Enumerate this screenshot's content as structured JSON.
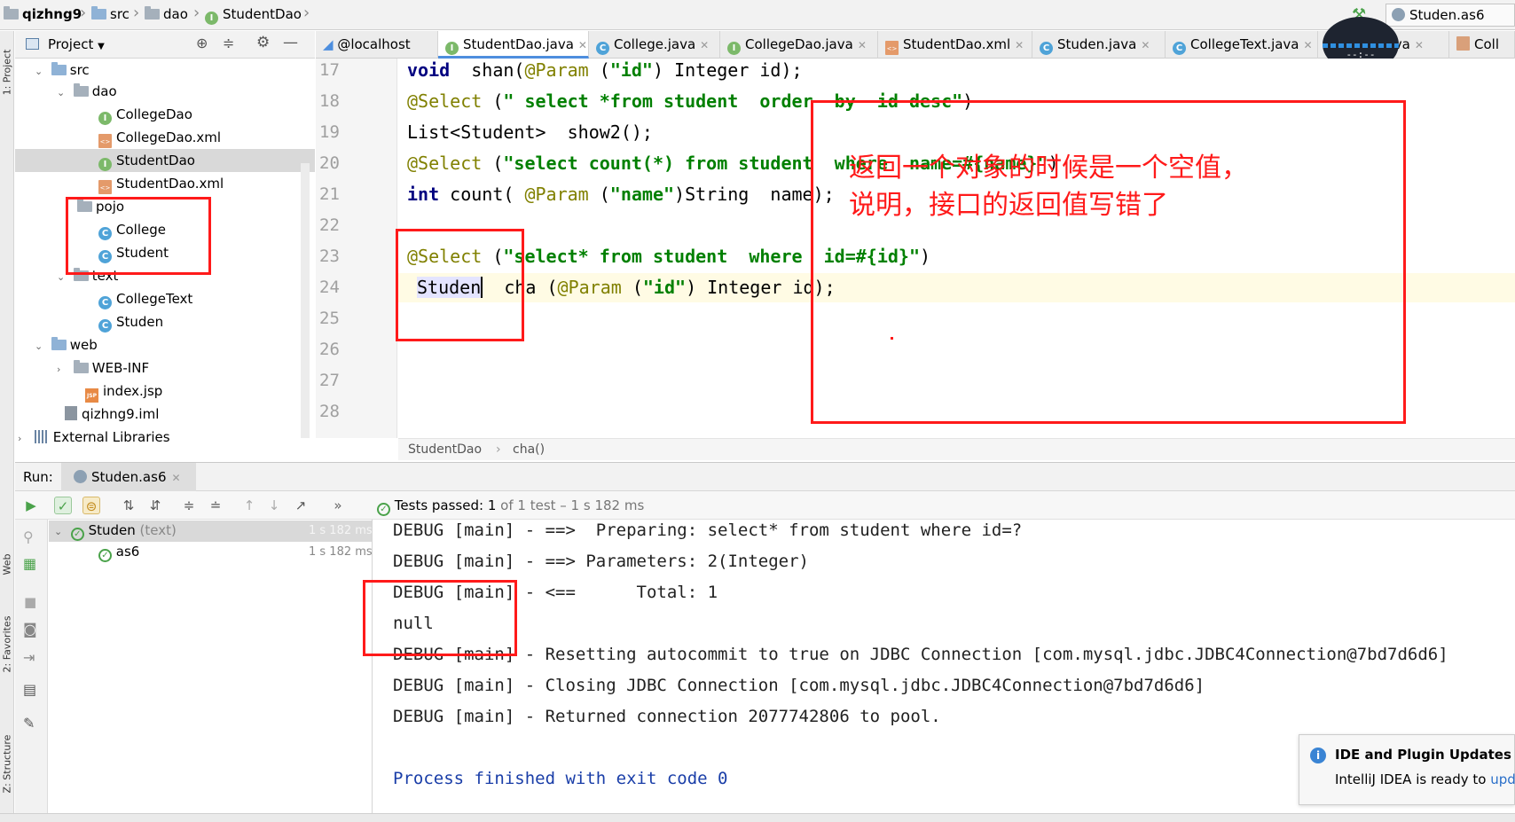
{
  "navbar": {
    "crumbs": [
      "qizhng9",
      "src",
      "dao",
      "StudentDao"
    ],
    "run_config": "Studen.as6"
  },
  "left_stripe": {
    "project": "1: Project",
    "web": "Web",
    "favorites": "2: Favorites",
    "structure": "Z: Structure"
  },
  "project_panel": {
    "title": "Project",
    "tree": [
      {
        "label": "src",
        "icon": "folder-icon"
      },
      {
        "label": "dao",
        "icon": "package-icon"
      },
      {
        "label": "CollegeDao",
        "icon": "interface-icon"
      },
      {
        "label": "CollegeDao.xml",
        "icon": "xml-file-icon"
      },
      {
        "label": "StudentDao",
        "icon": "interface-icon"
      },
      {
        "label": "StudentDao.xml",
        "icon": "xml-file-icon"
      },
      {
        "label": "pojo",
        "icon": "package-icon"
      },
      {
        "label": "College",
        "icon": "class-icon"
      },
      {
        "label": "Student",
        "icon": "class-icon"
      },
      {
        "label": "text",
        "icon": "package-icon"
      },
      {
        "label": "CollegeText",
        "icon": "class-icon"
      },
      {
        "label": "Studen",
        "icon": "class-icon"
      },
      {
        "label": "web",
        "icon": "folder-icon"
      },
      {
        "label": "WEB-INF",
        "icon": "folder-icon"
      },
      {
        "label": "index.jsp",
        "icon": "jsp-file-icon"
      },
      {
        "label": "qizhng9.iml",
        "icon": "iml-file-icon"
      },
      {
        "label": "External Libraries",
        "icon": "library-icon"
      }
    ]
  },
  "tabs": [
    {
      "label": "@localhost"
    },
    {
      "label": "StudentDao.java"
    },
    {
      "label": "College.java"
    },
    {
      "label": "CollegeDao.java"
    },
    {
      "label": "StudentDao.xml"
    },
    {
      "label": "Studen.java"
    },
    {
      "label": "CollegeText.java"
    },
    {
      "label": "udent.java"
    },
    {
      "label": "Coll"
    }
  ],
  "editor": {
    "line_numbers": [
      "17",
      "18",
      "19",
      "20",
      "21",
      "22",
      "23",
      "24",
      "25",
      "26",
      "27",
      "28"
    ],
    "lines": {
      "l17": {
        "a": "void",
        "b": "  shan(",
        "c": "@Param",
        "d": " (",
        "e": "\"id\"",
        "f": ") Integer id);"
      },
      "l18": {
        "a": "@Select",
        "b": " (",
        "c": "\" select *from student  order  by  id desc\"",
        "d": ")"
      },
      "l19": {
        "a": "List<Student>  show2();"
      },
      "l20": {
        "a": "@Select",
        "b": " (",
        "c": "\"select count(*) from student  where  name=#{name}\"",
        "d": ")"
      },
      "l21": {
        "a": "int",
        "b": " count( ",
        "c": "@Param",
        "d": " (",
        "e": "\"name\"",
        "f": ")String  name);"
      },
      "l23": {
        "a": "@Select",
        "b": " (",
        "c": "\"select* from student  where  id=#{id}\"",
        "d": ")"
      },
      "l24": {
        "a": "Studen",
        "b": "  cha (",
        "c": "@Param",
        "d": " (",
        "e": "\"id\"",
        "f": ") Integer id);"
      }
    },
    "breadcrumb": [
      "StudentDao",
      "cha()"
    ]
  },
  "annotation": {
    "line1": "返回一个对象的时候是一个空值，",
    "line2": "说明，接口的返回值写错了"
  },
  "run_panel": {
    "label": "Run:",
    "tab": "Studen.as6",
    "status_prefix": "Tests passed:",
    "status_count": "1",
    "status_rest": "of 1 test – 1 s 182 ms",
    "tests": [
      {
        "name": "Studen",
        "suffix": "(text)",
        "time": "1 s 182 ms"
      },
      {
        "name": "as6",
        "suffix": "",
        "time": "1 s 182 ms"
      }
    ],
    "console": [
      "DEBUG [main] - ==>  Preparing: select* from student where id=?",
      "DEBUG [main] - ==> Parameters: 2(Integer)",
      "DEBUG [main] - <==      Total: 1",
      "null",
      "DEBUG [main] - Resetting autocommit to true on JDBC Connection [com.mysql.jdbc.JDBC4Connection@7bd7d6d6]",
      "DEBUG [main] - Closing JDBC Connection [com.mysql.jdbc.JDBC4Connection@7bd7d6d6]",
      "DEBUG [main] - Returned connection 2077742806 to pool.",
      "",
      "Process finished with exit code 0"
    ]
  },
  "notification": {
    "title": "IDE and Plugin Updates",
    "body": "IntelliJ IDEA is ready to",
    "link": "upda"
  },
  "overlay_widget": {
    "text": "--:--"
  },
  "colors": {
    "annotation_red": "#ff1a1a",
    "keyword": "#000080",
    "string": "#008000",
    "annotation": "#808000",
    "active_tab": "#4d8ede"
  }
}
